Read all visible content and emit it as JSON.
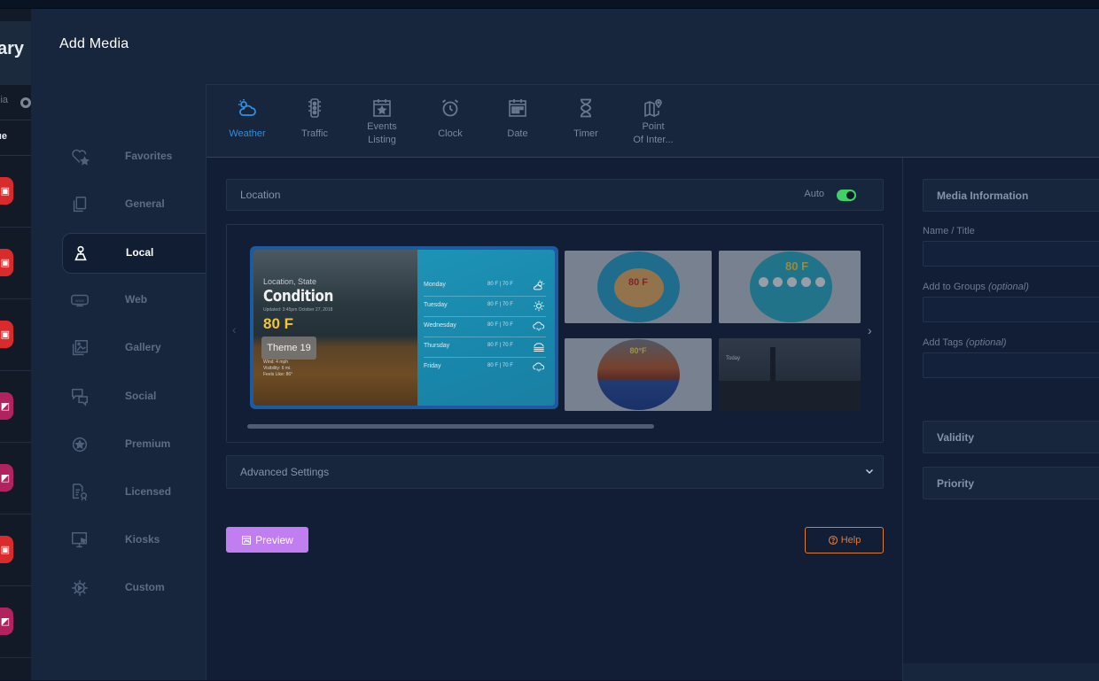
{
  "background_page": {
    "brand_fragment": "ary",
    "subnav_fragment": "ia",
    "row_fragment": "ue",
    "item_badge_colors": [
      "#d92b2b",
      "#d92b2b",
      "#d92b2b",
      "#b0235f",
      "#b0235f",
      "#d92b2b",
      "#b0235f"
    ]
  },
  "modal": {
    "title": "Add Media"
  },
  "sidebar": {
    "active": "Local",
    "items": [
      {
        "label": "Favorites",
        "icon": "heart-star-icon"
      },
      {
        "label": "General",
        "icon": "copy-icon"
      },
      {
        "label": "Local",
        "icon": "map-pin-person-icon"
      },
      {
        "label": "Web",
        "icon": "www-icon"
      },
      {
        "label": "Gallery",
        "icon": "images-icon"
      },
      {
        "label": "Social",
        "icon": "chat-bubbles-icon"
      },
      {
        "label": "Premium",
        "icon": "star-circle-icon"
      },
      {
        "label": "Licensed",
        "icon": "certificate-icon"
      },
      {
        "label": "Kiosks",
        "icon": "kiosk-monitor-icon"
      },
      {
        "label": "Custom",
        "icon": "gear-icon"
      }
    ]
  },
  "tabs": {
    "active": "Weather",
    "items": [
      {
        "label": "Weather",
        "icon": "cloud-sun-icon"
      },
      {
        "label": "Traffic",
        "icon": "traffic-light-icon"
      },
      {
        "label_line1": "Events",
        "label_line2": "Listing",
        "icon": "calendar-star-icon"
      },
      {
        "label": "Clock",
        "icon": "alarm-clock-icon"
      },
      {
        "label": "Date",
        "icon": "calendar-icon"
      },
      {
        "label": "Timer",
        "icon": "hourglass-icon"
      },
      {
        "label_line1": "Point",
        "label_line2": "Of Inter...",
        "icon": "map-pin-icon"
      }
    ]
  },
  "location": {
    "label": "Location",
    "auto_label": "Auto",
    "auto_enabled": true,
    "toggle_color": "#3fd06a"
  },
  "themes": {
    "selected": {
      "name": "Theme 19",
      "location": "Location, State",
      "condition": "Condition",
      "updated": "Updated: 3:45pm October 27, 2018",
      "temperature": "80 F",
      "details": [
        "Wind: 4 mph",
        "Visibility: 6 mi.",
        "Feels Like: 86°"
      ],
      "forecast": [
        {
          "day": "Monday",
          "temps": "80 F | 70 F",
          "icon": "partly-cloudy-icon"
        },
        {
          "day": "Tuesday",
          "temps": "80 F | 70 F",
          "icon": "sun-icon"
        },
        {
          "day": "Wednesday",
          "temps": "80 F | 70 F",
          "icon": "rain-cloud-icon"
        },
        {
          "day": "Thursday",
          "temps": "80 F | 70 F",
          "icon": "fog-icon"
        },
        {
          "day": "Friday",
          "temps": "80 F | 70 F",
          "icon": "rain-cloud-icon"
        }
      ]
    },
    "others": [
      {
        "temp": "80 F",
        "style": "circular-orange-center"
      },
      {
        "temp": "80 F",
        "style": "circular-teal-five-day"
      },
      {
        "temp": "80°F",
        "style": "circular-sunset"
      },
      {
        "temp": "",
        "style": "city-skyline-dark",
        "caption": "Today"
      }
    ],
    "prev_arrow": "‹",
    "next_arrow": "›"
  },
  "advanced_settings": {
    "label": "Advanced Settings"
  },
  "buttons": {
    "preview": "Preview",
    "help": "Help",
    "preview_color": "#c07ef0",
    "help_color": "#e07a3a"
  },
  "media_information": {
    "header": "Media Information",
    "fields": [
      {
        "label": "Name / Title",
        "optional": "",
        "value": ""
      },
      {
        "label": "Add to Groups",
        "optional": "(optional)",
        "value": ""
      },
      {
        "label": "Add Tags",
        "optional": "(optional)",
        "value": ""
      }
    ],
    "sections": [
      "Validity",
      "Priority"
    ]
  }
}
